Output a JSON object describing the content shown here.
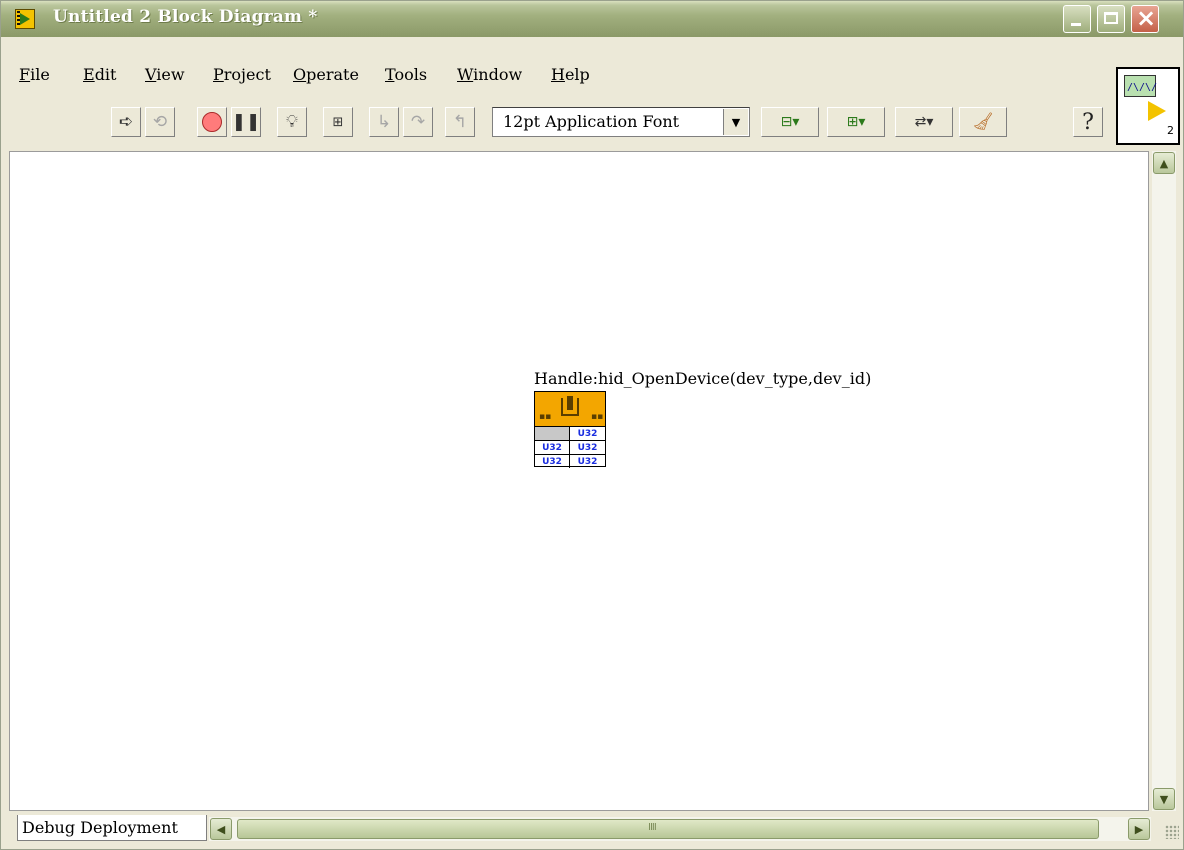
{
  "window": {
    "title": "Untitled 2 Block Diagram *"
  },
  "menu": [
    "File",
    "Edit",
    "View",
    "Project",
    "Operate",
    "Tools",
    "Window",
    "Help"
  ],
  "toolbar": {
    "font_select_value": "12pt Application Font",
    "help_label": "?"
  },
  "vi_icon": {
    "number": "2"
  },
  "diagram": {
    "node_label": "Handle:hid_OpenDevice(dev_type,dev_id)",
    "node_rows": [
      [
        "",
        "U32"
      ],
      [
        "U32",
        "U32"
      ],
      [
        "U32",
        "U32"
      ]
    ]
  },
  "status": {
    "tab_label": "Debug Deployment"
  },
  "colors": {
    "node_header": "#f3a600",
    "titlebar": "#a2b07f",
    "terminal_text": "#1a2de0"
  }
}
